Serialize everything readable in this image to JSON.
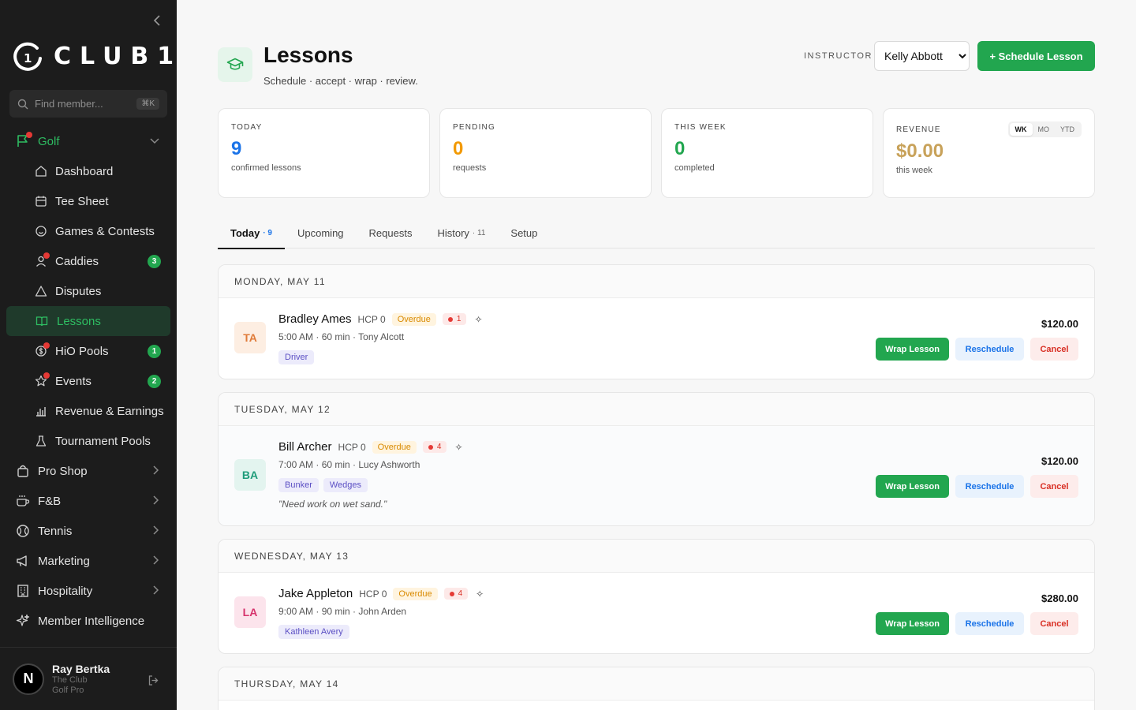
{
  "sidebar": {
    "brand": "CLUB1.",
    "brand_mark": "1",
    "search_placeholder": "Find member...",
    "search_shortcut": "⌘K",
    "items": [
      {
        "label": "Golf"
      },
      {
        "label": "Dashboard"
      },
      {
        "label": "Tee Sheet"
      },
      {
        "label": "Games & Contests"
      },
      {
        "label": "Caddies",
        "count": "3"
      },
      {
        "label": "Disputes"
      },
      {
        "label": "Lessons"
      },
      {
        "label": "HiO Pools",
        "count": "1"
      },
      {
        "label": "Events",
        "count": "2"
      },
      {
        "label": "Revenue & Earnings"
      },
      {
        "label": "Tournament Pools"
      },
      {
        "label": "Pro Shop"
      },
      {
        "label": "F&B"
      },
      {
        "label": "Tennis"
      },
      {
        "label": "Marketing"
      },
      {
        "label": "Hospitality"
      },
      {
        "label": "Member Intelligence"
      }
    ],
    "user": {
      "initial": "N",
      "name": "Ray Bertka",
      "club": "The Club",
      "role": "Golf Pro"
    }
  },
  "header": {
    "title": "Lessons",
    "subtitle": "Schedule · accept · wrap · review.",
    "instructor_label": "INSTRUCTOR",
    "instructor_selected": "Kelly Abbott",
    "schedule_button": "+ Schedule Lesson"
  },
  "stats": [
    {
      "label": "TODAY",
      "value": "9",
      "caption": "confirmed lessons",
      "color": "#1a73e8"
    },
    {
      "label": "PENDING",
      "value": "0",
      "caption": "requests",
      "color": "#f29900"
    },
    {
      "label": "THIS WEEK",
      "value": "0",
      "caption": "completed",
      "color": "#22a64f"
    },
    {
      "label": "REVENUE",
      "value": "$0.00",
      "caption": "this week",
      "color": "#c8a25a",
      "periods": [
        "WK",
        "MO",
        "YTD"
      ]
    }
  ],
  "tabs": [
    {
      "label": "Today",
      "count": "· 9"
    },
    {
      "label": "Upcoming",
      "count": ""
    },
    {
      "label": "Requests",
      "count": ""
    },
    {
      "label": "History",
      "count": "· 11"
    },
    {
      "label": "Setup",
      "count": ""
    }
  ],
  "days": [
    {
      "heading": "MONDAY, MAY 11",
      "lesson": {
        "initials": "TA",
        "name": "Bradley Ames",
        "hcp": "HCP 0",
        "status": "Overdue",
        "flag": "1",
        "meta": "5:00 AM · 60 min · Tony Alcott",
        "tags": [
          "Driver"
        ],
        "note": "",
        "price": "$120.00"
      }
    },
    {
      "heading": "TUESDAY, MAY 12",
      "lesson": {
        "initials": "BA",
        "name": "Bill Archer",
        "hcp": "HCP 0",
        "status": "Overdue",
        "flag": "4",
        "meta": "7:00 AM · 60 min · Lucy Ashworth",
        "tags": [
          "Bunker",
          "Wedges"
        ],
        "note": "\"Need work on wet sand.\"",
        "price": "$120.00"
      }
    },
    {
      "heading": "WEDNESDAY, MAY 13",
      "lesson": {
        "initials": "LA",
        "name": "Jake Appleton",
        "hcp": "HCP 0",
        "status": "Overdue",
        "flag": "4",
        "meta": "9:00 AM · 90 min · John Arden",
        "tags": [
          "Kathleen Avery"
        ],
        "note": "",
        "price": "$280.00"
      }
    },
    {
      "heading": "THURSDAY, MAY 14"
    }
  ],
  "actions": {
    "wrap": "Wrap Lesson",
    "reschedule": "Reschedule",
    "cancel": "Cancel"
  }
}
